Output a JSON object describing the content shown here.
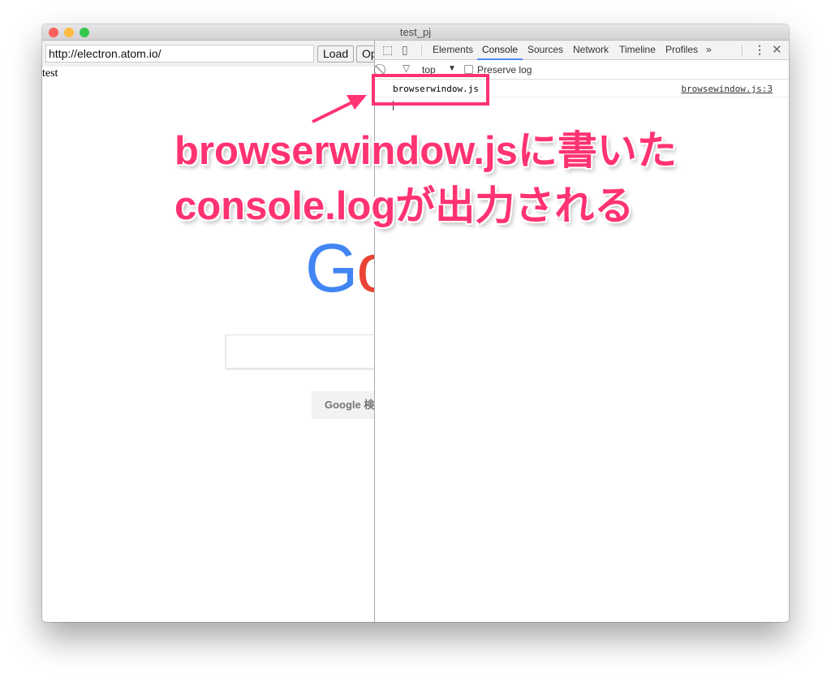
{
  "window": {
    "title": "test_pj"
  },
  "browser": {
    "url": "http://electron.atom.io/",
    "load_label": "Load",
    "open_label": "Op",
    "body_text": "test",
    "logo": "Google",
    "search_button": "Google 検索"
  },
  "devtools": {
    "tabs": [
      "Elements",
      "Console",
      "Sources",
      "Network",
      "Timeline",
      "Profiles"
    ],
    "active_tab": "Console",
    "more": "»",
    "context": "top",
    "preserve_log": "Preserve log",
    "preserve_log_checked": false,
    "log": {
      "message": "browserwindow.js",
      "source": "browsewindow.js:3"
    }
  },
  "annotation": {
    "line1": "browserwindow.jsに書いた",
    "line2": "console.logが出力される",
    "color": "#ff3372"
  }
}
